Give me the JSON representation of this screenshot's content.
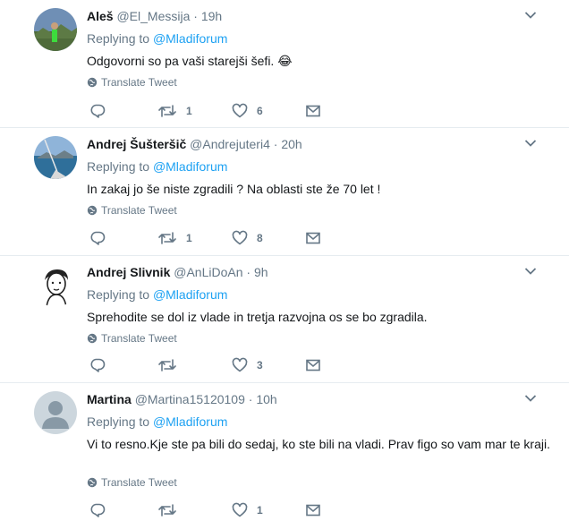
{
  "reply_prefix": "Replying to",
  "translate_label": "Translate Tweet",
  "tweets": [
    {
      "name": "Aleš",
      "handle": "@El_Messija",
      "time": "19h",
      "reply_to": "@Mladiforum",
      "text": "Odgovorni so pa vaši starejši šefi. 😂",
      "retweets": "1",
      "likes": "6"
    },
    {
      "name": "Andrej Šušteršič",
      "handle": "@Andrejuteri4",
      "time": "20h",
      "reply_to": "@Mladiforum",
      "text": "In zakaj jo še niste zgradili ? Na oblasti ste že 70 let !",
      "retweets": "1",
      "likes": "8"
    },
    {
      "name": "Andrej Slivnik",
      "handle": "@AnLiDoAn",
      "time": "9h",
      "reply_to": "@Mladiforum",
      "text": "Sprehodite se dol iz vlade in tretja razvojna os se bo zgradila.",
      "retweets": "",
      "likes": "3"
    },
    {
      "name": "Martina",
      "handle": "@Martina15120109",
      "time": "10h",
      "reply_to": "@Mladiforum",
      "text": "Vi to resno.Kje ste pa bili do sedaj, ko ste bili na vladi. Prav figo so vam mar te kraji.",
      "retweets": "",
      "likes": "1"
    }
  ]
}
